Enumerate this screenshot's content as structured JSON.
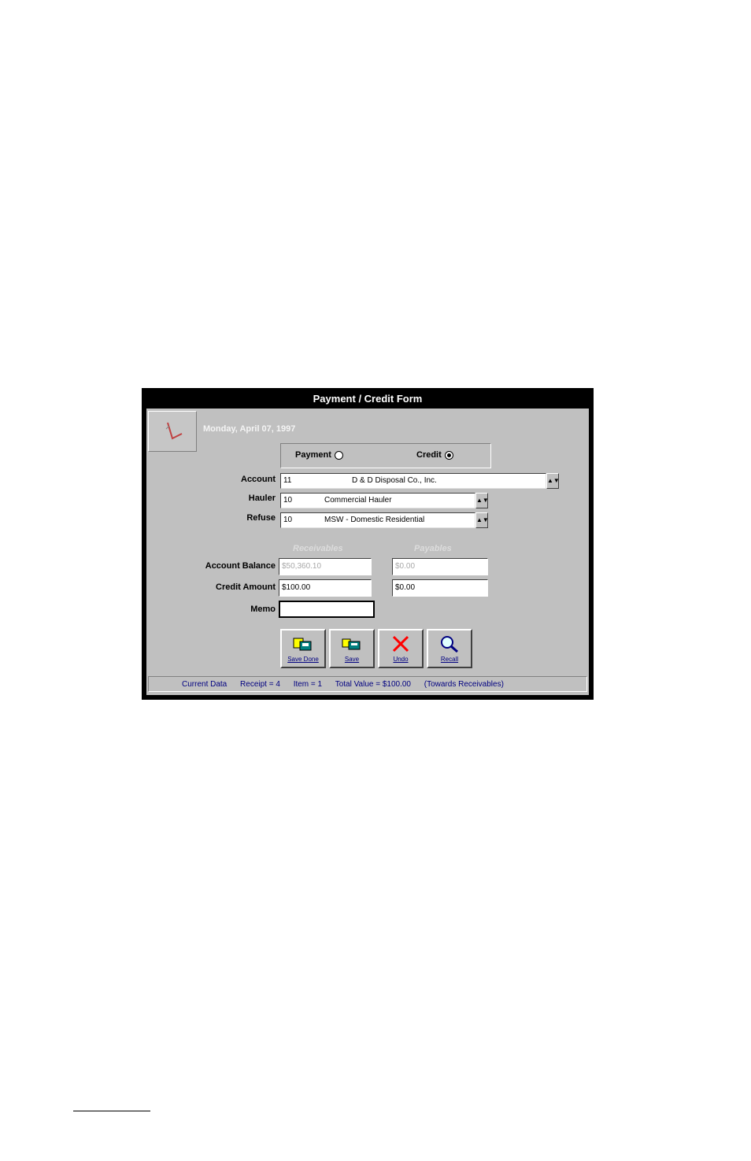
{
  "window": {
    "title": "Payment / Credit Form"
  },
  "header": {
    "date": "Monday, April 07, 1997"
  },
  "radio_group": {
    "payment": {
      "label": "Payment",
      "selected": false
    },
    "credit": {
      "label": "Credit",
      "selected": true
    }
  },
  "fields": {
    "account": {
      "label": "Account",
      "code": "11",
      "name": "D & D Disposal Co., Inc."
    },
    "hauler": {
      "label": "Hauler",
      "code": "10",
      "name": "Commercial Hauler"
    },
    "refuse": {
      "label": "Refuse",
      "code": "10",
      "name": "MSW - Domestic Residential"
    }
  },
  "columns": {
    "left": "Receivables",
    "right": "Payables"
  },
  "amounts": {
    "account_balance": {
      "label": "Account Balance",
      "receivables": "$50,360.10",
      "payables": "$0.00"
    },
    "credit_amount": {
      "label": "Credit Amount",
      "receivables": "$100.00",
      "payables": "$0.00"
    },
    "memo": {
      "label": "Memo",
      "value": ""
    }
  },
  "toolbar": {
    "save_done": "Save Done",
    "save": "Save",
    "undo": "Undo",
    "recall": "Recall"
  },
  "status": {
    "current": "Current Data",
    "receipt": "Receipt = 4",
    "item": "Item = 1",
    "total": "Total Value = $100.00",
    "towards": "(Towards Receivables)"
  },
  "colors": {
    "title_bar": "#000000",
    "client": "#c0c0c0",
    "status_text": "#000080",
    "undo_x": "#ff0000"
  },
  "icons": [
    "checkmark-icon",
    "save-done-icon",
    "save-icon",
    "undo-x-icon",
    "recall-magnifier-icon",
    "dropdown-arrow-icon"
  ]
}
